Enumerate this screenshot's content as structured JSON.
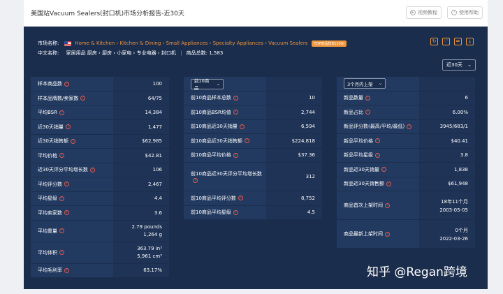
{
  "header": {
    "title": "美国站Vacuum Sealers(封口机)市场分析报告-近30天",
    "tutorial_label": "视频教程",
    "help_label": "使用帮助"
  },
  "market": {
    "name_label": "市场名称:",
    "breadcrumb": "Home & Kitchen › Kitchen & Dining › Small Appliances › Specialty Appliances › Vacuum Sealers",
    "bsr_badge": "TOP商品样本(100)",
    "cn_label": "中文名称:",
    "cn_breadcrumb": "家居用品 厨房 › 厨房 › 小家电 › 专业电器 › 封口机",
    "product_total": "商品总数: 1,583",
    "period": "近30天"
  },
  "col1": {
    "rows": [
      {
        "k": "样本商品数",
        "v": "100"
      },
      {
        "k": "样本品牌数/卖家数",
        "v": "64/75"
      },
      {
        "k": "平均BSR",
        "v": "14,384"
      },
      {
        "k": "近30天销量",
        "v": "1,477"
      },
      {
        "k": "近30天销售额",
        "v": "$62,985"
      },
      {
        "k": "平均价格",
        "v": "$42.81"
      },
      {
        "k": "近30天评分平均增长数",
        "v": "106"
      },
      {
        "k": "平均评分数",
        "v": "2,467"
      },
      {
        "k": "平均星级",
        "v": "4.4"
      },
      {
        "k": "平均卖家数",
        "v": "3.6"
      },
      {
        "k": "平均重量",
        "v": "2.79 pounds",
        "v2": "1,264 g"
      },
      {
        "k": "平均体积",
        "v": "363.79 in³",
        "v2": "5,961 cm³"
      },
      {
        "k": "平均毛利率",
        "v": "63.17%"
      }
    ]
  },
  "col2": {
    "select": "前10商品",
    "rows": [
      {
        "k": "前10商品样本总数",
        "v": "10"
      },
      {
        "k": "前10商品BSR均值",
        "v": "2,744"
      },
      {
        "k": "前10商品近30天销量",
        "v": "6,594"
      },
      {
        "k": "前10商品近30天销售额",
        "v": "$224,818"
      },
      {
        "k": "前10商品平均价格",
        "v": "$37.36"
      },
      {
        "k": "前10商品近30天评分平均增长数",
        "v": "312"
      },
      {
        "k": "前10商品平均评分数",
        "v": "8,752"
      },
      {
        "k": "前10商品平均星级",
        "v": "4.5"
      }
    ]
  },
  "col3": {
    "select": "3个月内上架",
    "rows": [
      {
        "k": "新品数量",
        "v": "6"
      },
      {
        "k": "新品占比",
        "v": "6.00%"
      },
      {
        "k": "新品评分数(最高/平均/最低)",
        "v": "3945/683/1"
      },
      {
        "k": "新品平均价格",
        "v": "$40.41"
      },
      {
        "k": "新品平均星级",
        "v": "3.8"
      },
      {
        "k": "新品近30天销量",
        "v": "1,838"
      },
      {
        "k": "新品近30天销售额",
        "v": "$61,948"
      },
      {
        "k": "商品首次上架时间",
        "v": "18年11个月",
        "v2": "2003-05-05"
      },
      {
        "k": "商品最新上架时间",
        "v": "0个月",
        "v2": "2022-03-26"
      }
    ]
  },
  "watermark": "知乎 @Regan跨境",
  "colors": {
    "panel": "#1b2d4d",
    "accent": "#f0953b",
    "help_icon": "#e05a4f"
  }
}
